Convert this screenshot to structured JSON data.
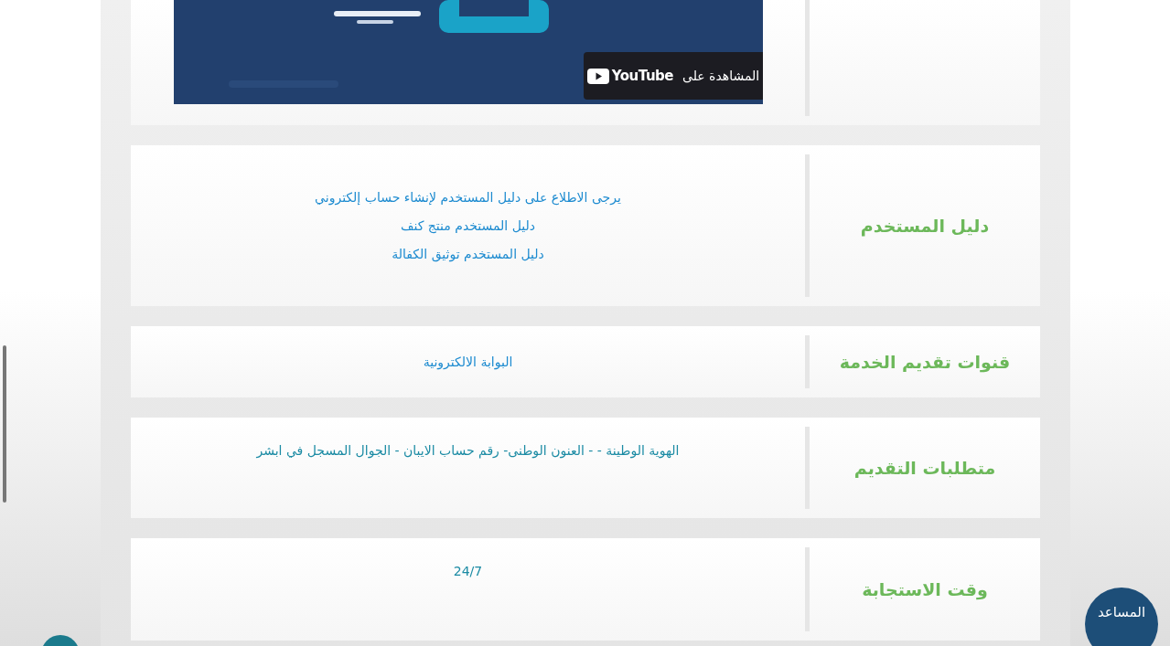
{
  "video": {
    "kind": "picture",
    "overlay": {
      "label": "المشاهدة على",
      "brand": "YouTube"
    }
  },
  "rows": [
    {
      "label": "دليل المستخدم",
      "kind": "links",
      "items": [
        "يرجى الاطلاع على دليل المستخدم لإنشاء حساب إلكتروني",
        "دليل المستخدم منتج كنف",
        "دليل المستخدم توثيق الكفالة"
      ]
    },
    {
      "label": "قنوات تقديم الخدمة",
      "kind": "links",
      "items": [
        "البوابة الالكترونية"
      ]
    },
    {
      "label": "متطلبات التقديم",
      "kind": "text",
      "items": [
        "الهوية الوطينة - - العنون الوطنى- رقم حساب الايبان - الجوال المسجل في ابشر"
      ]
    },
    {
      "label": "وقت الاستجابة",
      "kind": "text",
      "items": [
        "24/7"
      ]
    }
  ],
  "assistant": {
    "label": "المساعد"
  }
}
